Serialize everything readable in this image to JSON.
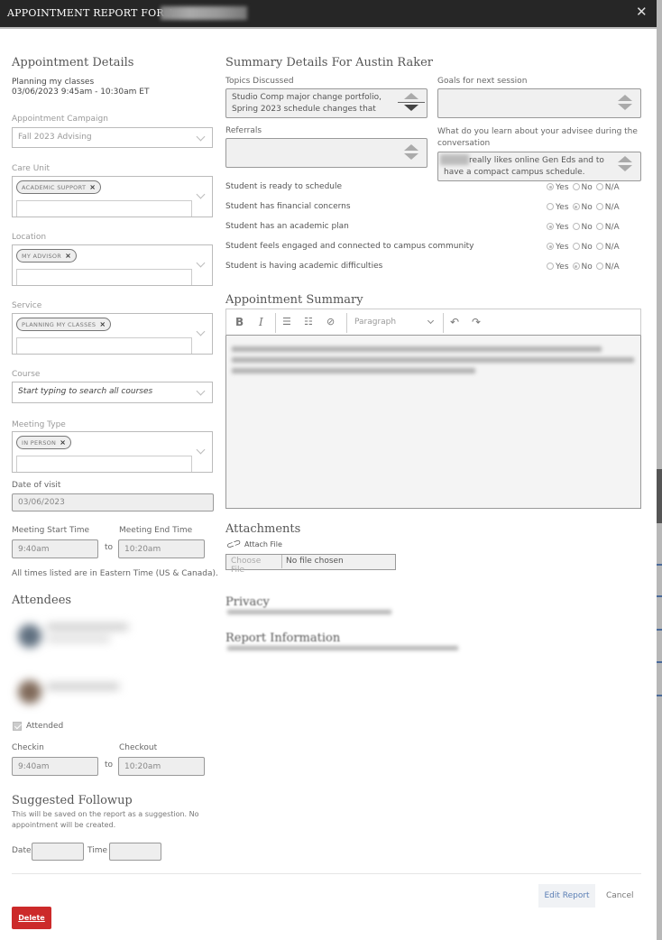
{
  "modal": {
    "title": "APPOINTMENT REPORT FOR A",
    "close_icon": "close-icon"
  },
  "details": {
    "heading": "Appointment Details",
    "service_line": "Planning my classes",
    "datetime_line": "03/06/2023 9:45am - 10:30am ET",
    "campaign": {
      "label": "Appointment Campaign",
      "value": "Fall 2023 Advising"
    },
    "care_unit": {
      "label": "Care Unit",
      "tag": "Academic Support"
    },
    "location": {
      "label": "Location",
      "tag": "My Advisor"
    },
    "service": {
      "label": "Service",
      "tag": "Planning my classes"
    },
    "course": {
      "label": "Course",
      "placeholder": "Start typing to search all courses"
    },
    "meeting_type": {
      "label": "Meeting Type",
      "tag": "In Person"
    },
    "date_of_visit": {
      "label": "Date of visit",
      "value": "03/06/2023"
    },
    "start_time": {
      "label": "Meeting Start Time",
      "value": "9:40am"
    },
    "end_time": {
      "label": "Meeting End Time",
      "value": "10:20am"
    },
    "to_label": "to",
    "timezone_note": "All times listed are in Eastern Time (US & Canada)."
  },
  "attendees": {
    "heading": "Attendees",
    "attended_label": "Attended",
    "attended": true,
    "checkin": {
      "label": "Checkin",
      "value": "9:40am"
    },
    "checkout": {
      "label": "Checkout",
      "value": "10:20am"
    },
    "to_label": "to"
  },
  "followup": {
    "heading": "Suggested Followup",
    "note": "This will be saved on the report as a suggestion. No appointment will be created.",
    "date_label": "Date",
    "time_label": "Time",
    "date_value": "",
    "time_value": ""
  },
  "summary": {
    "heading": "Summary Details For Austin Raker",
    "topics": {
      "label": "Topics Discussed",
      "value": "Studio Comp major change portfolio, Spring 2023 schedule changes that"
    },
    "goals": {
      "label": "Goals for next session",
      "value": ""
    },
    "referrals": {
      "label": "Referrals",
      "value": ""
    },
    "learned": {
      "label": "What do you learn about your advisee during the conversation",
      "value": "really likes online Gen Eds and to have a compact campus schedule."
    },
    "radio_options": [
      "Yes",
      "No",
      "N/A"
    ],
    "questions": [
      {
        "label": "Student is ready to schedule",
        "selected": "Yes"
      },
      {
        "label": "Student has financial concerns",
        "selected": "No"
      },
      {
        "label": "Student has an academic plan",
        "selected": "Yes"
      },
      {
        "label": "Student feels engaged and connected to campus community",
        "selected": "Yes"
      },
      {
        "label": "Student is having academic difficulties",
        "selected": "No"
      }
    ]
  },
  "appointment_summary": {
    "heading": "Appointment Summary",
    "toolbar": {
      "bold": "B",
      "italic": "I",
      "bullet_list_icon": "bullet-list-icon",
      "numbered_list_icon": "numbered-list-icon",
      "link_icon": "link-icon",
      "format_value": "Paragraph",
      "undo_icon": "undo-icon",
      "redo_icon": "redo-icon"
    }
  },
  "attachments": {
    "heading": "Attachments",
    "attach_label": "Attach File",
    "choose_label": "Choose File",
    "no_file_label": "No file chosen"
  },
  "privacy": {
    "heading": "Privacy"
  },
  "report_info": {
    "heading": "Report Information"
  },
  "footer": {
    "edit_label": "Edit Report",
    "cancel_label": "Cancel",
    "delete_label": "Delete"
  },
  "colors": {
    "titlebar": "#262626",
    "delete": "#cc2a2a",
    "edit_text": "#5b7fb5"
  }
}
